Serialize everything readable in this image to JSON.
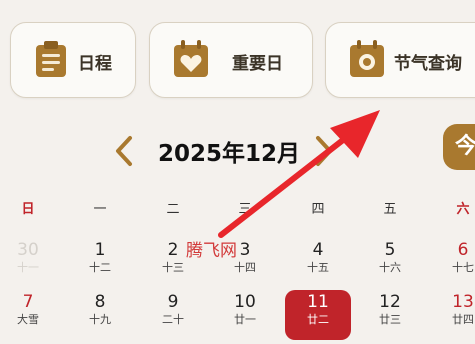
{
  "colors": {
    "accent": "#a9792f",
    "red": "#c0242a",
    "background": "#f4f1ed"
  },
  "quick_actions": [
    {
      "label": "日程",
      "icon": "clipboard-schedule-icon"
    },
    {
      "label": "重要日",
      "icon": "calendar-heart-icon"
    },
    {
      "label": "节气查询",
      "icon": "calendar-sun-icon"
    }
  ],
  "calendar": {
    "month_title": "2025年12月",
    "today_button": "今",
    "weekdays": [
      "日",
      "一",
      "二",
      "三",
      "四",
      "五",
      "六"
    ],
    "rows": [
      [
        {
          "day": "30",
          "lunar": "十一",
          "style": "dim"
        },
        {
          "day": "1",
          "lunar": "十二",
          "style": ""
        },
        {
          "day": "2",
          "lunar": "十三",
          "style": ""
        },
        {
          "day": "3",
          "lunar": "十四",
          "style": ""
        },
        {
          "day": "4",
          "lunar": "十五",
          "style": ""
        },
        {
          "day": "5",
          "lunar": "十六",
          "style": ""
        },
        {
          "day": "6",
          "lunar": "十七",
          "style": "red"
        }
      ],
      [
        {
          "day": "7",
          "lunar": "大雪",
          "style": "red"
        },
        {
          "day": "8",
          "lunar": "十九",
          "style": ""
        },
        {
          "day": "9",
          "lunar": "二十",
          "style": ""
        },
        {
          "day": "10",
          "lunar": "廿一",
          "style": ""
        },
        {
          "day": "11",
          "lunar": "廿二",
          "style": "today"
        },
        {
          "day": "12",
          "lunar": "廿三",
          "style": ""
        },
        {
          "day": "13",
          "lunar": "廿四",
          "style": "red"
        }
      ]
    ]
  },
  "watermark": "腾飞网",
  "annotation": {
    "type": "red-arrow",
    "color": "#e8262b"
  }
}
